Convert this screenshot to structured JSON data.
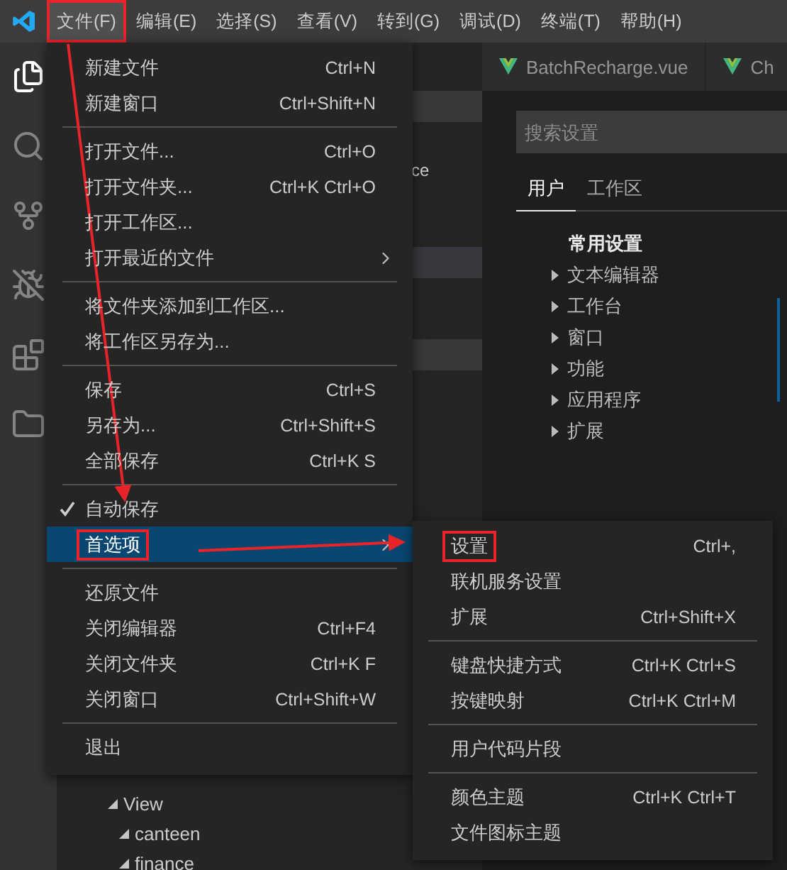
{
  "menubar": [
    {
      "label": "文件(F)",
      "selected": true,
      "annotated": true
    },
    {
      "label": "编辑(E)",
      "selected": false,
      "annotated": false
    },
    {
      "label": "选择(S)",
      "selected": false,
      "annotated": false
    },
    {
      "label": "查看(V)",
      "selected": false,
      "annotated": false
    },
    {
      "label": "转到(G)",
      "selected": false,
      "annotated": false
    },
    {
      "label": "调试(D)",
      "selected": false,
      "annotated": false
    },
    {
      "label": "终端(T)",
      "selected": false,
      "annotated": false
    },
    {
      "label": "帮助(H)",
      "selected": false,
      "annotated": false
    }
  ],
  "tabs": [
    {
      "label": "BatchRecharge.vue"
    },
    {
      "label": "Ch"
    }
  ],
  "sidebar": {
    "fragment": "ce",
    "tree": [
      {
        "label": "View",
        "expanded": true,
        "children": [
          {
            "label": "canteen",
            "expanded": true
          },
          {
            "label": "finance",
            "expanded": true
          }
        ]
      }
    ]
  },
  "settings": {
    "search": {
      "placeholder": "搜索设置"
    },
    "scopes": [
      {
        "label": "用户",
        "selected": true
      },
      {
        "label": "工作区",
        "selected": false
      }
    ],
    "heading": "常用设置",
    "groups": [
      {
        "label": "文本编辑器"
      },
      {
        "label": "工作台"
      },
      {
        "label": "窗口"
      },
      {
        "label": "功能"
      },
      {
        "label": "应用程序"
      },
      {
        "label": "扩展"
      }
    ]
  },
  "file_menu": {
    "groups": [
      [
        {
          "label": "新建文件",
          "shortcut": "Ctrl+N",
          "checked": false,
          "selected": false,
          "submenu": false,
          "annotated": false
        },
        {
          "label": "新建窗口",
          "shortcut": "Ctrl+Shift+N",
          "checked": false,
          "selected": false,
          "submenu": false,
          "annotated": false
        }
      ],
      [
        {
          "label": "打开文件...",
          "shortcut": "Ctrl+O",
          "checked": false,
          "selected": false,
          "submenu": false,
          "annotated": false
        },
        {
          "label": "打开文件夹...",
          "shortcut": "Ctrl+K Ctrl+O",
          "checked": false,
          "selected": false,
          "submenu": false,
          "annotated": false
        },
        {
          "label": "打开工作区...",
          "checked": false,
          "selected": false,
          "submenu": false,
          "annotated": false
        },
        {
          "label": "打开最近的文件",
          "checked": false,
          "selected": false,
          "submenu": true,
          "annotated": false
        }
      ],
      [
        {
          "label": "将文件夹添加到工作区...",
          "checked": false,
          "selected": false,
          "submenu": false,
          "annotated": false
        },
        {
          "label": "将工作区另存为...",
          "checked": false,
          "selected": false,
          "submenu": false,
          "annotated": false
        }
      ],
      [
        {
          "label": "保存",
          "shortcut": "Ctrl+S",
          "checked": false,
          "selected": false,
          "submenu": false,
          "annotated": false
        },
        {
          "label": "另存为...",
          "shortcut": "Ctrl+Shift+S",
          "checked": false,
          "selected": false,
          "submenu": false,
          "annotated": false
        },
        {
          "label": "全部保存",
          "shortcut": "Ctrl+K S",
          "checked": false,
          "selected": false,
          "submenu": false,
          "annotated": false
        }
      ],
      [
        {
          "label": "自动保存",
          "checked": true,
          "selected": false,
          "submenu": false,
          "annotated": false
        },
        {
          "label": "首选项",
          "checked": false,
          "selected": true,
          "submenu": true,
          "annotated": true
        }
      ],
      [
        {
          "label": "还原文件",
          "checked": false,
          "selected": false,
          "submenu": false,
          "annotated": false
        },
        {
          "label": "关闭编辑器",
          "shortcut": "Ctrl+F4",
          "checked": false,
          "selected": false,
          "submenu": false,
          "annotated": false
        },
        {
          "label": "关闭文件夹",
          "shortcut": "Ctrl+K F",
          "checked": false,
          "selected": false,
          "submenu": false,
          "annotated": false
        },
        {
          "label": "关闭窗口",
          "shortcut": "Ctrl+Shift+W",
          "checked": false,
          "selected": false,
          "submenu": false,
          "annotated": false
        }
      ],
      [
        {
          "label": "退出",
          "checked": false,
          "selected": false,
          "submenu": false,
          "annotated": false
        }
      ]
    ]
  },
  "preferences_menu": {
    "groups": [
      [
        {
          "label": "设置",
          "shortcut": "Ctrl+,",
          "checked": false,
          "selected": false,
          "submenu": false,
          "annotated": true
        },
        {
          "label": "联机服务设置",
          "checked": false,
          "selected": false,
          "submenu": false,
          "annotated": false
        },
        {
          "label": "扩展",
          "shortcut": "Ctrl+Shift+X",
          "checked": false,
          "selected": false,
          "submenu": false,
          "annotated": false
        }
      ],
      [
        {
          "label": "键盘快捷方式",
          "shortcut": "Ctrl+K Ctrl+S",
          "checked": false,
          "selected": false,
          "submenu": false,
          "annotated": false
        },
        {
          "label": "按键映射",
          "shortcut": "Ctrl+K Ctrl+M",
          "checked": false,
          "selected": false,
          "submenu": false,
          "annotated": false
        }
      ],
      [
        {
          "label": "用户代码片段",
          "checked": false,
          "selected": false,
          "submenu": false,
          "annotated": false
        }
      ],
      [
        {
          "label": "颜色主题",
          "shortcut": "Ctrl+K Ctrl+T",
          "checked": false,
          "selected": false,
          "submenu": false,
          "annotated": false
        },
        {
          "label": "文件图标主题",
          "checked": false,
          "selected": false,
          "submenu": false,
          "annotated": false
        }
      ]
    ]
  }
}
